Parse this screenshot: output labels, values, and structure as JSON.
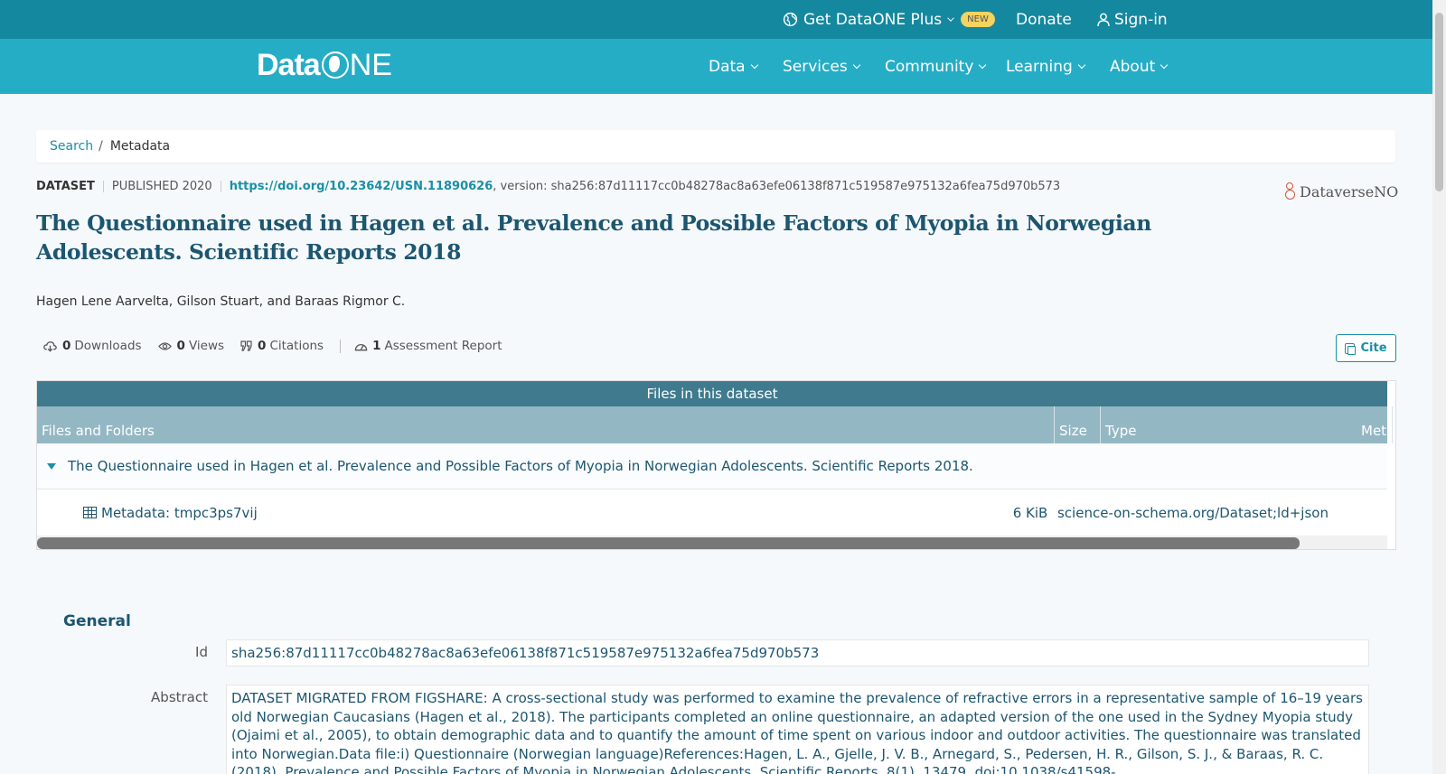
{
  "topbar": {
    "plus_label": "Get DataONE Plus",
    "new_badge": "NEW",
    "donate_label": "Donate",
    "signin_label": "Sign-in"
  },
  "nav": {
    "logo_left": "Data",
    "logo_right": "NE",
    "items": [
      "Data",
      "Services",
      "Community",
      "Learning",
      "About"
    ]
  },
  "breadcrumb": {
    "search": "Search",
    "separator": "/",
    "current": "Metadata"
  },
  "dataset": {
    "type": "DATASET",
    "published": "PUBLISHED 2020",
    "doi": "https://doi.org/10.23642/USN.11890626",
    "version": ", version: sha256:87d11117cc0b48278ac8a63efe06138f871c519587e975132a6fea75d970b573",
    "repository": "DataverseNO",
    "title": "The Questionnaire used in Hagen et al. Prevalence and Possible Factors of Myopia in Norwegian Adolescents. Scientific Reports 2018",
    "authors": "Hagen Lene Aarvelta, Gilson Stuart, and Baraas Rigmor C."
  },
  "stats": {
    "downloads_count": "0",
    "downloads_label": "Downloads",
    "views_count": "0",
    "views_label": "Views",
    "citations_count": "0",
    "citations_label": "Citations",
    "assessment_count": "1",
    "assessment_label": "Assessment Report"
  },
  "cite_label": "Cite",
  "files": {
    "header": "Files in this dataset",
    "columns": [
      "Files and Folders",
      "Size",
      "Type",
      "Met"
    ],
    "folder_name": "The Questionnaire used in Hagen et al. Prevalence and Possible Factors of Myopia in Norwegian Adolescents. Scientific Reports 2018.",
    "file_name": "Metadata: tmpc3ps7vij",
    "file_size": "6 KiB",
    "file_type": "science-on-schema.org/Dataset;ld+json"
  },
  "general": {
    "section_title": "General",
    "id_label": "Id",
    "id_value": "sha256:87d11117cc0b48278ac8a63efe06138f871c519587e975132a6fea75d970b573",
    "abstract_label": "Abstract",
    "abstract_value": "DATASET MIGRATED FROM FIGSHARE: A cross-sectional study was performed to examine the prevalence of refractive errors in a representative sample of 16–19 years old Norwegian Caucasians (Hagen et al., 2018). The participants completed an online questionnaire, an adapted version of the one used in the Sydney Myopia study (Ojaimi et al., 2005), to obtain demographic data and to quantify the amount of time spent on various indoor and outdoor activities. The questionnaire was translated into Norwegian.Data file:i) Questionnaire (Norwegian language)References:Hagen, L. A., Gjelle, J. V. B., Arnegard, S., Pedersen, H. R., Gilson, S. J., & Baraas, R. C. (2018). Prevalence and Possible Factors of Myopia in Norwegian Adolescents. Scientific Reports, 8(1), 13479. doi:10.1038/s41598-"
  },
  "colors": {
    "topbar": "#14889f",
    "nav": "#26adc6",
    "title": "#1c5670",
    "link": "#1a8fa6",
    "files_header": "#3f7a8e",
    "columns_header": "#94b7c4"
  }
}
